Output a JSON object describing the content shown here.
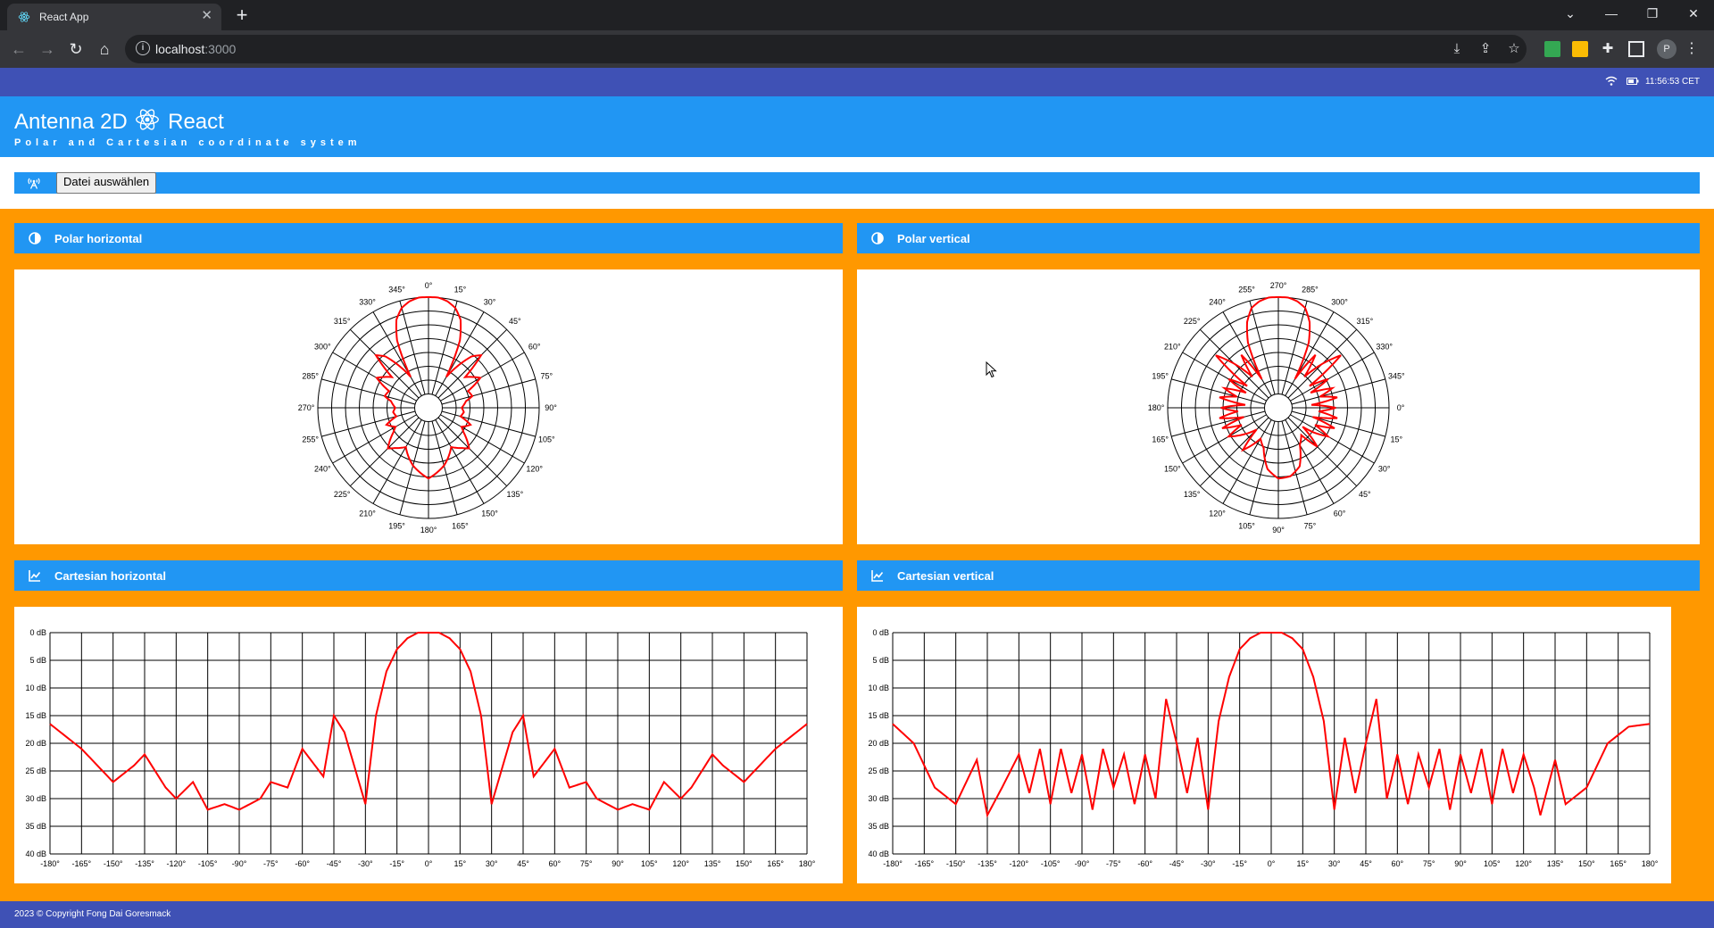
{
  "browser": {
    "tab_title": "React App",
    "url_host": "localhost",
    "url_port": ":3000"
  },
  "os": {
    "clock": "11:56:53 CET"
  },
  "app": {
    "title_left": "Antenna 2D",
    "title_right": "React",
    "subtitle": "Polar and Cartesian coordinate system",
    "file_button": "Datei auswählen",
    "footer": "2023 © Copyright Fong Dai Goresmack"
  },
  "colors": {
    "primary": "#2196f3",
    "accent": "#ff9800",
    "dark": "#3f51b5",
    "trace": "#ff0000"
  },
  "panels": {
    "polar_h": "Polar horizontal",
    "polar_v": "Polar vertical",
    "cart_h": "Cartesian horizontal",
    "cart_v": "Cartesian vertical"
  },
  "chart_data": [
    {
      "type": "polar",
      "id": "polar_h",
      "angle_labels": [
        "0°",
        "15°",
        "30°",
        "45°",
        "60°",
        "75°",
        "90°",
        "105°",
        "120°",
        "135°",
        "150°",
        "165°",
        "180°",
        "195°",
        "210°",
        "225°",
        "240°",
        "255°",
        "270°",
        "285°",
        "300°",
        "315°",
        "330°",
        "345°"
      ],
      "angle_start_label": "0°",
      "direction": "clockwise",
      "rings": 8,
      "db_range": [
        -40,
        0
      ],
      "series": [
        {
          "angles": [
            -180,
            -165,
            -150,
            -140,
            -135,
            -125,
            -120,
            -112,
            -105,
            -97,
            -90,
            -80,
            -75,
            -67,
            -60,
            -50,
            -45,
            -40,
            -30,
            -25,
            -20,
            -15,
            -10,
            -5,
            0,
            5,
            10,
            15,
            20,
            25,
            30,
            40,
            45,
            50,
            60,
            67,
            75,
            80,
            90,
            97,
            105,
            112,
            120,
            125,
            135,
            140,
            150,
            165,
            180
          ],
          "db": [
            -16.5,
            -21,
            -27,
            -24,
            -22,
            -28,
            -30,
            -27,
            -32,
            -31,
            -32,
            -30,
            -27,
            -28,
            -21,
            -26,
            -15,
            -18,
            -31,
            -15,
            -7,
            -3,
            -1,
            0,
            0,
            0,
            -1,
            -3,
            -7,
            -15,
            -31,
            -18,
            -15,
            -26,
            -21,
            -28,
            -27,
            -30,
            -32,
            -31,
            -32,
            -27,
            -30,
            -28,
            -22,
            -24,
            -27,
            -21,
            -16.5
          ]
        }
      ]
    },
    {
      "type": "polar",
      "id": "polar_v",
      "angle_labels": [
        "270°",
        "285°",
        "300°",
        "315°",
        "330°",
        "345°",
        "0°",
        "15°",
        "30°",
        "45°",
        "60°",
        "75°",
        "90°",
        "105°",
        "120°",
        "135°",
        "150°",
        "165°",
        "180°",
        "195°",
        "210°",
        "225°",
        "240°",
        "255°"
      ],
      "angle_start_label": "270°",
      "direction": "clockwise",
      "rings": 8,
      "db_range": [
        -40,
        0
      ],
      "series": [
        {
          "angles": [
            -180,
            -170,
            -160,
            -150,
            -140,
            -135,
            -128,
            -120,
            -115,
            -110,
            -105,
            -100,
            -95,
            -90,
            -85,
            -80,
            -75,
            -70,
            -65,
            -60,
            -55,
            -50,
            -45,
            -40,
            -35,
            -30,
            -25,
            -20,
            -15,
            -10,
            -5,
            0,
            5,
            10,
            15,
            20,
            25,
            30,
            35,
            40,
            45,
            50,
            55,
            60,
            65,
            70,
            75,
            80,
            85,
            90,
            95,
            100,
            105,
            110,
            115,
            120,
            125,
            128,
            135,
            140,
            150,
            160,
            170,
            180
          ],
          "db": [
            -16.5,
            -20,
            -28,
            -31,
            -23,
            -33,
            -28,
            -22,
            -29,
            -21,
            -31,
            -21,
            -29,
            -22,
            -32,
            -21,
            -28,
            -22,
            -31,
            -22,
            -30,
            -12,
            -20,
            -29,
            -19,
            -32,
            -16,
            -8,
            -3,
            -1,
            0,
            0,
            0,
            -1,
            -3,
            -8,
            -16,
            -32,
            -19,
            -29,
            -20,
            -12,
            -30,
            -22,
            -31,
            -22,
            -28,
            -21,
            -32,
            -22,
            -29,
            -21,
            -31,
            -21,
            -29,
            -22,
            -28,
            -33,
            -23,
            -31,
            -28,
            -20,
            -17,
            -16.5
          ]
        }
      ]
    },
    {
      "type": "line",
      "id": "cart_h",
      "x_ticks": [
        "-180°",
        "-165°",
        "-150°",
        "-135°",
        "-120°",
        "-105°",
        "-90°",
        "-75°",
        "-60°",
        "-45°",
        "-30°",
        "-15°",
        "0°",
        "15°",
        "30°",
        "45°",
        "60°",
        "75°",
        "90°",
        "105°",
        "120°",
        "135°",
        "150°",
        "165°",
        "180°"
      ],
      "y_ticks": [
        "0 dB",
        "5 dB",
        "10 dB",
        "15 dB",
        "20 dB",
        "25 dB",
        "30 dB",
        "35 dB",
        "40 dB"
      ],
      "xlim": [
        -180,
        180
      ],
      "ylim": [
        -40,
        0
      ],
      "grid": true,
      "ref": 0
    },
    {
      "type": "line",
      "id": "cart_v",
      "x_ticks": [
        "-180°",
        "-165°",
        "-150°",
        "-135°",
        "-120°",
        "-105°",
        "-90°",
        "-75°",
        "-60°",
        "-45°",
        "-30°",
        "-15°",
        "0°",
        "15°",
        "30°",
        "45°",
        "60°",
        "75°",
        "90°",
        "105°",
        "120°",
        "135°",
        "150°",
        "165°",
        "180°"
      ],
      "y_ticks": [
        "0 dB",
        "5 dB",
        "10 dB",
        "15 dB",
        "20 dB",
        "25 dB",
        "30 dB",
        "35 dB",
        "40 dB"
      ],
      "xlim": [
        -180,
        180
      ],
      "ylim": [
        -40,
        0
      ],
      "grid": true,
      "ref": 1
    }
  ]
}
